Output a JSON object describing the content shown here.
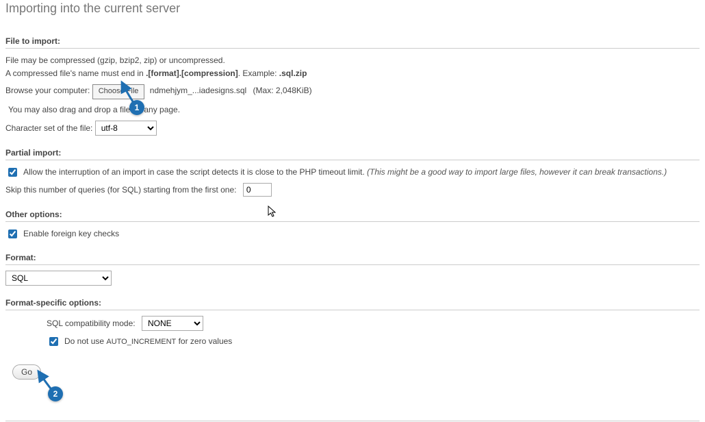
{
  "pageTitle": "Importing into the current server",
  "fileImport": {
    "heading": "File to import:",
    "compressNote1": "File may be compressed (gzip, bzip2, zip) or uncompressed.",
    "compressNote2a": "A compressed file's name must end in ",
    "compressNote2b": ".[format].[compression]",
    "compressNote2c": ". Example: ",
    "compressNote2d": ".sql.zip",
    "browseLabel": "Browse your computer:",
    "chooseFileBtn": "Choose File",
    "chosenFile": "ndmehjym_...iadesigns.sql",
    "maxSize": "(Max: 2,048KiB)",
    "dragDropNote": "You may also drag and drop a file on any page.",
    "charsetLabel": "Character set of the file:",
    "charsetValue": "utf-8"
  },
  "partial": {
    "heading": "Partial import:",
    "allowInterruptLabel": "Allow the interruption of an import in case the script detects it is close to the PHP timeout limit. ",
    "allowInterruptHint": "(This might be a good way to import large files, however it can break transactions.)",
    "skipLabel": "Skip this number of queries (for SQL) starting from the first one:",
    "skipValue": "0"
  },
  "other": {
    "heading": "Other options:",
    "fkLabel": "Enable foreign key checks"
  },
  "format": {
    "heading": "Format:",
    "value": "SQL"
  },
  "formatSpecific": {
    "heading": "Format-specific options:",
    "compatLabel": "SQL compatibility mode:",
    "compatValue": "NONE",
    "autoIncrPre": "Do not use ",
    "autoIncrCode": "AUTO_INCREMENT",
    "autoIncrPost": " for zero values"
  },
  "goBtn": "Go",
  "markers": {
    "one": "1",
    "two": "2"
  }
}
